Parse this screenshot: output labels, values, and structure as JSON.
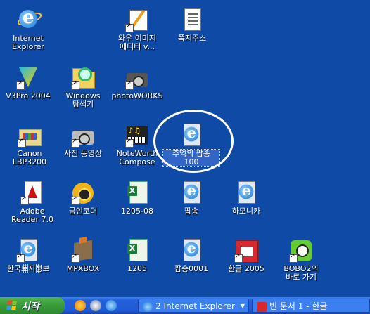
{
  "desktop": {
    "icons": [
      {
        "key": "internet-explorer",
        "label": "Internet\nExplorer",
        "icon": "ie-icon"
      },
      {
        "key": "wow-image-editor",
        "label": "와우 이미지\n에디터 v...",
        "icon": "image-editor-icon"
      },
      {
        "key": "address",
        "label": "쪽지주소",
        "icon": "notepad-icon"
      },
      {
        "key": "v3pro",
        "label": "V3Pro 2004",
        "icon": "v3-icon"
      },
      {
        "key": "windows-explorer",
        "label": "Windows\n탐색기",
        "icon": "explorer-icon"
      },
      {
        "key": "photoworks",
        "label": "photoWORKS",
        "icon": "camera-icon"
      },
      {
        "key": "canon",
        "label": "Canon\nLBP3200",
        "icon": "printer-folder-icon"
      },
      {
        "key": "photo-video",
        "label": "사진 동영상",
        "icon": "camera-icon"
      },
      {
        "key": "noteworthy",
        "label": "NoteWorth\nCompose",
        "icon": "music-icon"
      },
      {
        "key": "memory-popsong",
        "label": "추억의 팝송\n100",
        "icon": "ie-page-icon"
      },
      {
        "key": "adobe-reader",
        "label": "Adobe\nReader 7.0",
        "icon": "pdf-icon"
      },
      {
        "key": "gom-encoder",
        "label": "곰인코더",
        "icon": "gom-icon"
      },
      {
        "key": "f1205-08",
        "label": "1205-08",
        "icon": "excel-icon"
      },
      {
        "key": "popsong",
        "label": "팝송",
        "icon": "ie-page-icon"
      },
      {
        "key": "harmonica",
        "label": "하모니카",
        "icon": "ie-page-icon"
      },
      {
        "key": "land-info",
        "label": "한국토지정보",
        "icon": "ie-page-icon"
      },
      {
        "key": "mpxbox",
        "label": "MPXBOX",
        "icon": "mpx-icon"
      },
      {
        "key": "f1205",
        "label": "1205",
        "icon": "excel-icon"
      },
      {
        "key": "popsong0001",
        "label": "팝송0001",
        "icon": "ie-page-icon"
      },
      {
        "key": "hangul2005",
        "label": "한글 2005",
        "icon": "hangul-icon"
      },
      {
        "key": "bobo",
        "label": "BOBO2의\n바로 가기",
        "icon": "bobo-icon"
      }
    ]
  },
  "taskbar": {
    "start_label": "시작",
    "quick_launch": [
      "outlook-icon",
      "media-icon",
      "ie-icon"
    ],
    "tasks": [
      {
        "label": "2 Internet Explorer",
        "icon": "ie-icon"
      },
      {
        "label": "빈 문서 1 - 한글",
        "icon": "hangul-icon"
      }
    ]
  },
  "colors": {
    "desktop": "#0f4aa6",
    "start": "#3a9a3a",
    "taskbar": "#245edb"
  }
}
